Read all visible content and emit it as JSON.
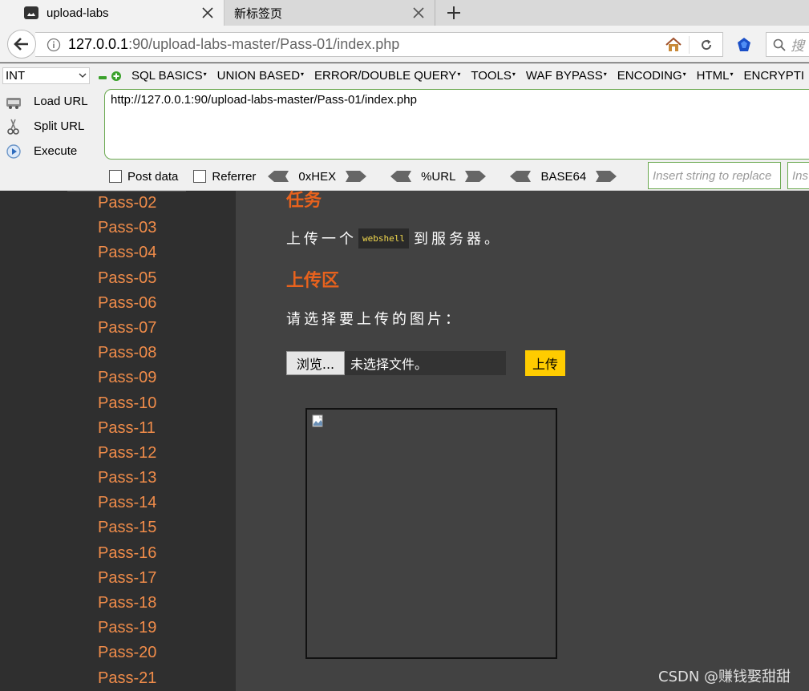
{
  "browser": {
    "tabs": [
      {
        "label": "upload-labs",
        "active": true
      },
      {
        "label": "新标签页",
        "active": false
      }
    ],
    "url_host": "127.0.0.1",
    "url_rest": ":90/upload-labs-master/Pass-01/index.php",
    "search_placeholder": "搜"
  },
  "hackbar": {
    "select_value": "INT",
    "menu": [
      "SQL BASICS",
      "UNION BASED",
      "ERROR/DOUBLE QUERY",
      "TOOLS",
      "WAF BYPASS",
      "ENCODING",
      "HTML",
      "ENCRYPTI"
    ],
    "actions": [
      {
        "label": "Load URL",
        "icon": "load-url-icon"
      },
      {
        "label": "Split URL",
        "icon": "scissors-icon"
      },
      {
        "label": "Execute",
        "icon": "execute-icon"
      }
    ],
    "url_value": "http://127.0.0.1:90/upload-labs-master/Pass-01/index.php",
    "post_data_label": "Post data",
    "referrer_label": "Referrer",
    "hex_label": "0xHEX",
    "url_label": "%URL",
    "base64_label": "BASE64",
    "replace_placeholder": "Insert string to replace",
    "replace_with_placeholder": "Ins"
  },
  "sidebar": {
    "items": [
      "Pass-02",
      "Pass-03",
      "Pass-04",
      "Pass-05",
      "Pass-06",
      "Pass-07",
      "Pass-08",
      "Pass-09",
      "Pass-10",
      "Pass-11",
      "Pass-12",
      "Pass-13",
      "Pass-14",
      "Pass-15",
      "Pass-16",
      "Pass-17",
      "Pass-18",
      "Pass-19",
      "Pass-20",
      "Pass-21"
    ]
  },
  "main": {
    "task_heading": "任务",
    "task_text_before": "上传一个",
    "task_code": "webshell",
    "task_text_after": "到服务器。",
    "upload_heading": "上传区",
    "select_label": "请选择要上传的图片：",
    "browse_label": "浏览...",
    "file_status": "未选择文件。",
    "submit_label": "上传"
  },
  "watermark": "CSDN @赚钱娶甜甜",
  "colors": {
    "accent_orange": "#e8621d",
    "link_orange": "#f08c4a",
    "submit_yellow": "#ffcc00",
    "sidebar_bg": "#2f2f2f",
    "main_bg": "#424242"
  }
}
